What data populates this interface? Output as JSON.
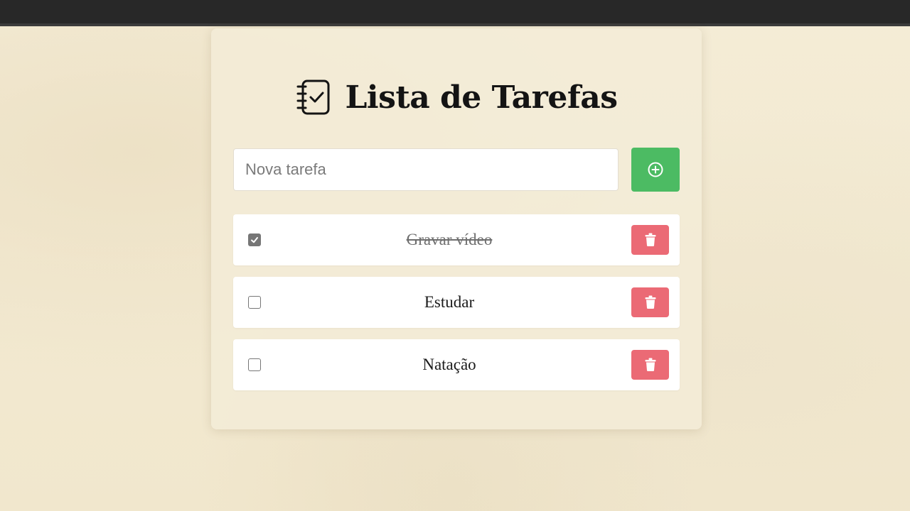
{
  "title": "Lista de Tarefas",
  "title_icon": "checklist-notebook-icon",
  "input": {
    "placeholder": "Nova tarefa",
    "value": ""
  },
  "add_button": {
    "icon": "plus-circle-icon"
  },
  "delete_icon": "trash-icon",
  "tasks": [
    {
      "text": "Gravar vídeo",
      "done": true
    },
    {
      "text": "Estudar",
      "done": false
    },
    {
      "text": "Natação",
      "done": false
    }
  ],
  "colors": {
    "add_button": "#4cbb63",
    "delete_button": "#eb6a75",
    "background": "#f3ead4",
    "topbar": "#282828"
  }
}
